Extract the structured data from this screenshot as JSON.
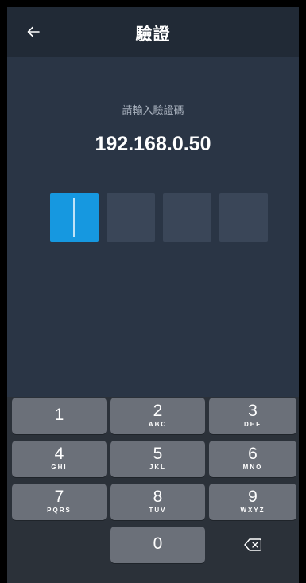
{
  "header": {
    "title": "驗證",
    "back_icon": "arrow-left-icon"
  },
  "main": {
    "prompt": "請輸入驗證碼",
    "host": "192.168.0.50",
    "code_length": 4,
    "active_box_color": "#1698e0"
  },
  "keypad": {
    "keys": [
      {
        "digit": "1",
        "letters": ""
      },
      {
        "digit": "2",
        "letters": "ABC"
      },
      {
        "digit": "3",
        "letters": "DEF"
      },
      {
        "digit": "4",
        "letters": "GHI"
      },
      {
        "digit": "5",
        "letters": "JKL"
      },
      {
        "digit": "6",
        "letters": "MNO"
      },
      {
        "digit": "7",
        "letters": "PQRS"
      },
      {
        "digit": "8",
        "letters": "TUV"
      },
      {
        "digit": "9",
        "letters": "WXYZ"
      },
      {
        "digit": "0",
        "letters": ""
      }
    ],
    "backspace_icon": "backspace-icon"
  }
}
